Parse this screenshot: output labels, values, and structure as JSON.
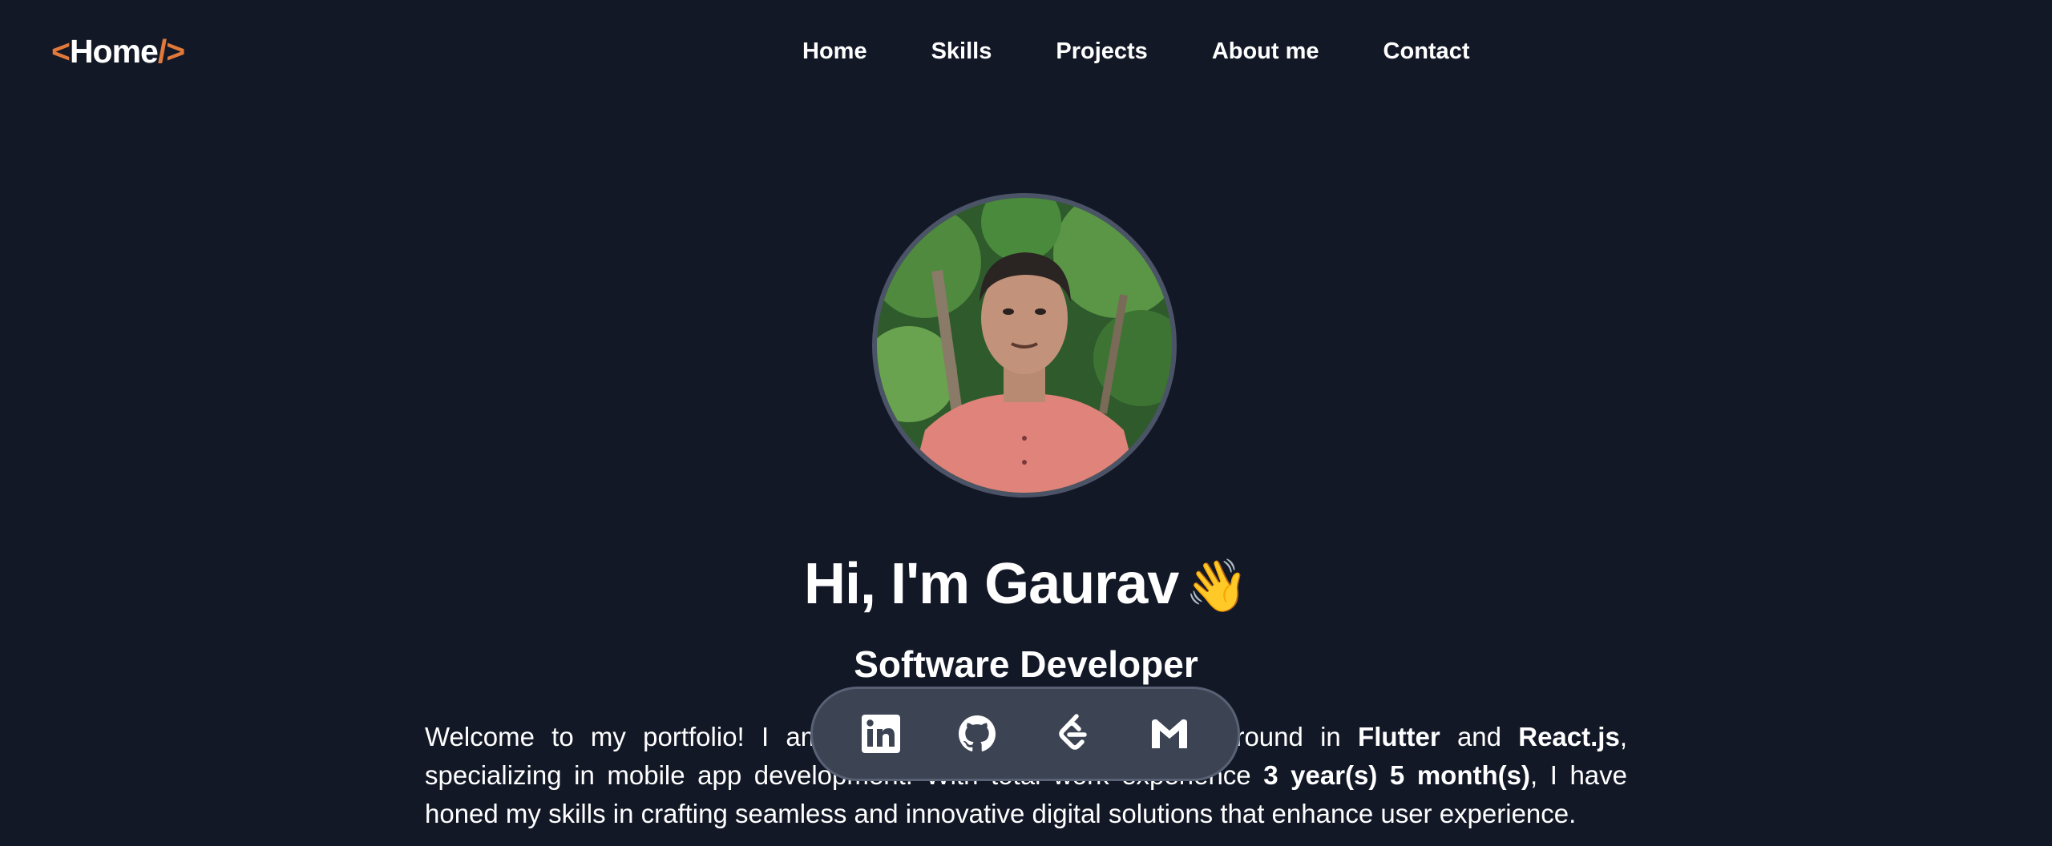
{
  "header": {
    "logo": {
      "open": "<",
      "text": "Home",
      "close": "/>"
    },
    "nav": [
      {
        "label": "Home"
      },
      {
        "label": "Skills"
      },
      {
        "label": "Projects"
      },
      {
        "label": "About me"
      },
      {
        "label": "Contact"
      }
    ]
  },
  "hero": {
    "title": "Hi, I'm Gaurav",
    "wave_emoji": "👋",
    "subtitle": "Software Developer",
    "intro": {
      "t1": "Welcome to my portfolio! I am Ga",
      "t2": "veloper with a strong background in ",
      "flutter": "Flutter",
      "t3": " and ",
      "react": "React.js",
      "t4": ", specializing in mobile app development. With total work experience ",
      "experience": "3 year(s) 5 month(s)",
      "t5": ", I have honed my skills in crafting seamless and innovative digital solutions that enhance user experience."
    }
  },
  "social": [
    {
      "name": "linkedin",
      "icon": "linkedin-icon"
    },
    {
      "name": "github",
      "icon": "github-icon"
    },
    {
      "name": "leetcode",
      "icon": "leetcode-icon"
    },
    {
      "name": "gmail",
      "icon": "gmail-icon"
    }
  ],
  "colors": {
    "background": "#131827",
    "accent": "#e0793a",
    "social_bar": "#3c4353",
    "avatar_ring": "#4b5366"
  }
}
